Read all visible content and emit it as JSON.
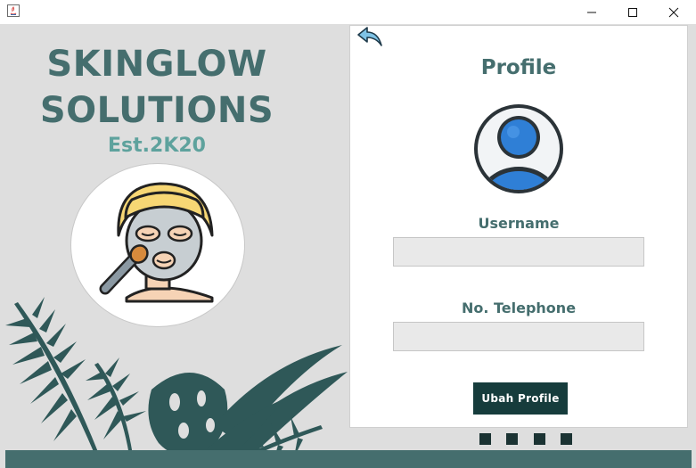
{
  "window": {
    "controls": [
      "minimize",
      "maximize",
      "close"
    ]
  },
  "brand": {
    "line1": "SKINGLOW",
    "line2": "SOLUTIONS",
    "established": "Est.2K20"
  },
  "profile": {
    "title": "Profile",
    "username_label": "Username",
    "username_value": "",
    "telephone_label": "No. Telephone",
    "telephone_value": "",
    "submit_label": "Ubah Profile"
  },
  "icons": {
    "app": "java-icon",
    "back": "back-arrow-icon",
    "profile": "user-avatar-icon",
    "brand": "face-mask-icon"
  },
  "colors": {
    "brand_text": "#456e6e",
    "est_text": "#5ea29d",
    "button_bg": "#163c3c",
    "leaf": "#2f5858",
    "bottom_bar": "#456e6e",
    "avatar_blue": "#2f7fd6"
  },
  "decor": {
    "square_count": 4
  }
}
